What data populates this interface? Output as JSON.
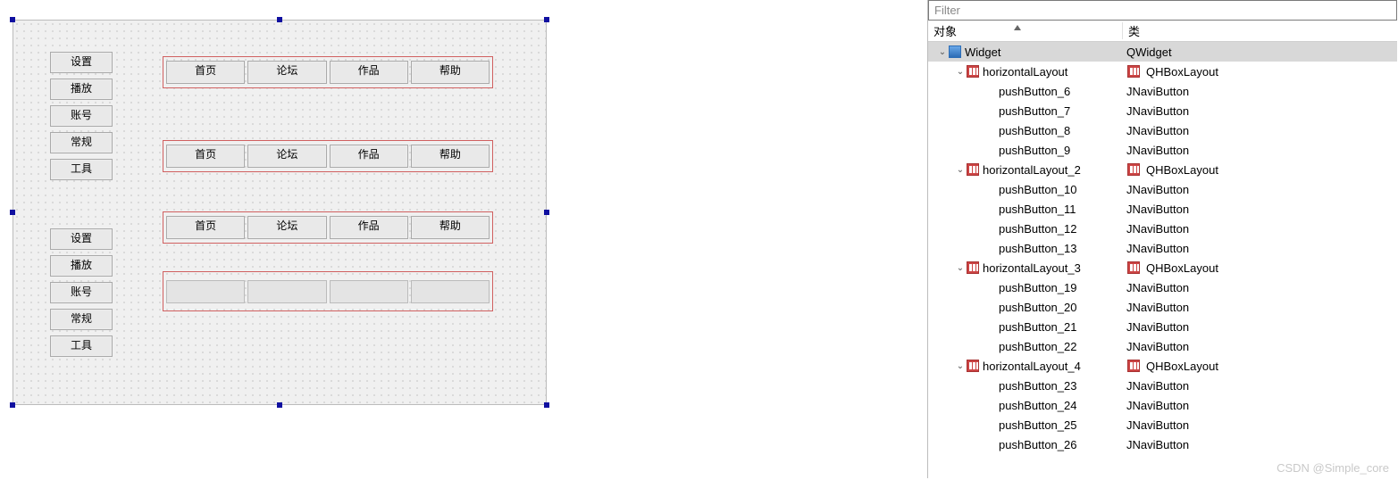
{
  "designer": {
    "vbox_labels": [
      "设置",
      "播放",
      "账号",
      "常规",
      "工具"
    ],
    "hrows": [
      {
        "labels": [
          "首页",
          "论坛",
          "作品",
          "帮助"
        ]
      },
      {
        "labels": [
          "首页",
          "论坛",
          "作品",
          "帮助"
        ]
      },
      {
        "labels": [
          "首页",
          "论坛",
          "作品",
          "帮助"
        ]
      },
      {
        "labels": [
          "",
          "",
          "",
          ""
        ]
      }
    ]
  },
  "inspector": {
    "filter_placeholder": "Filter",
    "headers": {
      "object": "对象",
      "class": "类"
    },
    "tree": [
      {
        "depth": 0,
        "expand": "open",
        "icon": "widget",
        "name": "Widget",
        "cls": "QWidget",
        "clsIcon": "",
        "selected": true
      },
      {
        "depth": 1,
        "expand": "open",
        "icon": "layout",
        "name": "horizontalLayout",
        "cls": "QHBoxLayout",
        "clsIcon": "layout"
      },
      {
        "depth": 2,
        "expand": "",
        "icon": "",
        "name": "pushButton_6",
        "cls": "JNaviButton"
      },
      {
        "depth": 2,
        "expand": "",
        "icon": "",
        "name": "pushButton_7",
        "cls": "JNaviButton"
      },
      {
        "depth": 2,
        "expand": "",
        "icon": "",
        "name": "pushButton_8",
        "cls": "JNaviButton"
      },
      {
        "depth": 2,
        "expand": "",
        "icon": "",
        "name": "pushButton_9",
        "cls": "JNaviButton"
      },
      {
        "depth": 1,
        "expand": "open",
        "icon": "layout",
        "name": "horizontalLayout_2",
        "cls": "QHBoxLayout",
        "clsIcon": "layout"
      },
      {
        "depth": 2,
        "expand": "",
        "icon": "",
        "name": "pushButton_10",
        "cls": "JNaviButton"
      },
      {
        "depth": 2,
        "expand": "",
        "icon": "",
        "name": "pushButton_11",
        "cls": "JNaviButton"
      },
      {
        "depth": 2,
        "expand": "",
        "icon": "",
        "name": "pushButton_12",
        "cls": "JNaviButton"
      },
      {
        "depth": 2,
        "expand": "",
        "icon": "",
        "name": "pushButton_13",
        "cls": "JNaviButton"
      },
      {
        "depth": 1,
        "expand": "open",
        "icon": "layout",
        "name": "horizontalLayout_3",
        "cls": "QHBoxLayout",
        "clsIcon": "layout"
      },
      {
        "depth": 2,
        "expand": "",
        "icon": "",
        "name": "pushButton_19",
        "cls": "JNaviButton"
      },
      {
        "depth": 2,
        "expand": "",
        "icon": "",
        "name": "pushButton_20",
        "cls": "JNaviButton"
      },
      {
        "depth": 2,
        "expand": "",
        "icon": "",
        "name": "pushButton_21",
        "cls": "JNaviButton"
      },
      {
        "depth": 2,
        "expand": "",
        "icon": "",
        "name": "pushButton_22",
        "cls": "JNaviButton"
      },
      {
        "depth": 1,
        "expand": "open",
        "icon": "layout",
        "name": "horizontalLayout_4",
        "cls": "QHBoxLayout",
        "clsIcon": "layout"
      },
      {
        "depth": 2,
        "expand": "",
        "icon": "",
        "name": "pushButton_23",
        "cls": "JNaviButton"
      },
      {
        "depth": 2,
        "expand": "",
        "icon": "",
        "name": "pushButton_24",
        "cls": "JNaviButton"
      },
      {
        "depth": 2,
        "expand": "",
        "icon": "",
        "name": "pushButton_25",
        "cls": "JNaviButton"
      },
      {
        "depth": 2,
        "expand": "",
        "icon": "",
        "name": "pushButton_26",
        "cls": "JNaviButton"
      }
    ]
  },
  "watermark": "CSDN @Simple_core"
}
